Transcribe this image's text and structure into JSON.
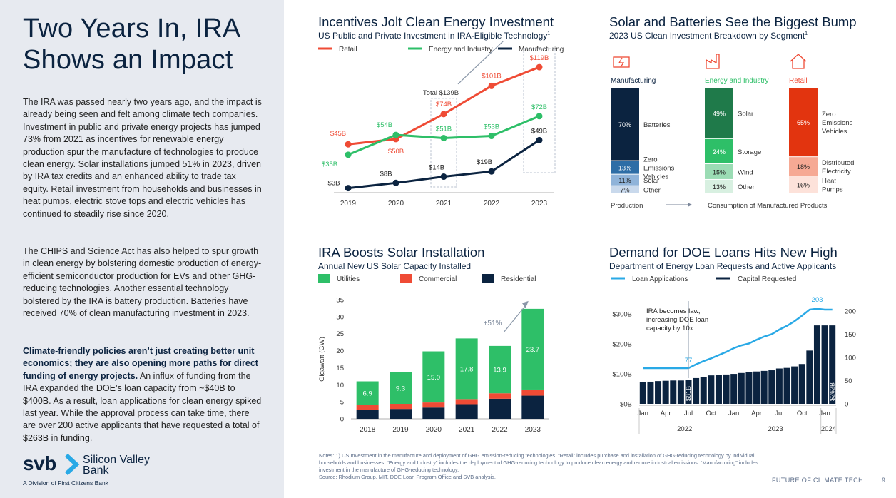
{
  "sidebar": {
    "title": "Two Years In, IRA Shows an Impact",
    "para1": "The IRA was passed nearly two years ago, and the impact is already being seen and felt among climate tech companies. Investment in public and private energy projects has jumped 73% from 2021 as incentives for renewable energy production spur the manufacture of technologies to produce clean energy. Solar installations jumped 51% in 2023, driven by IRA tax credits and an enhanced ability to trade tax equity. Retail investment from households and businesses in heat pumps, electric stove tops and electric vehicles has continued to steadily rise since 2020.",
    "para2": "The CHIPS and Science Act has also helped to spur growth in clean energy by bolstering domestic production of energy-efficient semiconductor production for EVs and other GHG-reducing technologies. Another essential technology bolstered by the IRA is battery production. Batteries have received 70% of clean manufacturing investment in 2023.",
    "para3_bold": "Climate-friendly policies aren’t just creating better unit economics; they are also opening more paths for direct funding of energy projects.",
    "para3_rest": " An influx of funding from the IRA expanded the DOE’s loan capacity from ~$40B to $400B. As a result, loan applications for clean energy spiked last year. While the approval process can take time, there are over 200 active applicants that have requested a total of $263B in funding.",
    "logo_mark": "svb",
    "logo_name_1": "Silicon Valley",
    "logo_name_2": "Bank",
    "logo_division": "A Division of First Citizens Bank"
  },
  "chart1": {
    "title": "Incentives Jolt Clean Energy Investment",
    "subtitle": "US Public and Private Investment in IRA-Eligible Technology",
    "subtitle_note": "1"
  },
  "chart2": {
    "title": "Solar and Batteries See the Biggest Bump",
    "subtitle": "2023 US Clean Investment Breakdown by Segment",
    "subtitle_note": "1"
  },
  "chart3": {
    "title": "IRA Boosts Solar Installation",
    "subtitle": "Annual New US Solar Capacity Installed"
  },
  "chart4": {
    "title": "Demand for DOE Loans Hits New High",
    "subtitle": "Department of Energy Loan Requests and Active Applicants"
  },
  "chart_data": [
    {
      "type": "line",
      "x": [
        "2019",
        "2020",
        "2021",
        "2022",
        "2023"
      ],
      "series": [
        {
          "name": "Retail",
          "color": "#ef4b35",
          "values": [
            45,
            50,
            74,
            101,
            119
          ],
          "labels": [
            "$45B",
            "$50B",
            "$74B",
            "$101B",
            "$119B"
          ]
        },
        {
          "name": "Energy and Industry",
          "color": "#2ebf68",
          "values": [
            35,
            54,
            51,
            53,
            72
          ],
          "labels": [
            "$35B",
            "$54B",
            "$51B",
            "$53B",
            "$72B"
          ]
        },
        {
          "name": "Manufacturing",
          "color": "#0b2340",
          "values": [
            3,
            8,
            14,
            19,
            49
          ],
          "labels": [
            "$3B",
            "$8B",
            "$14B",
            "$19B",
            "$49B"
          ]
        }
      ],
      "annotations": {
        "total_2021": "Total $139B",
        "total_2023": "Total $240B",
        "growth": "+73%"
      },
      "ylim": [
        0,
        130
      ]
    },
    {
      "type": "bar",
      "stacked": true,
      "percent": true,
      "segments": [
        {
          "name": "Manufacturing",
          "color": "#0b2340",
          "parts": [
            {
              "label": "Batteries",
              "value": 70,
              "text": "70%",
              "color": "#0b2340"
            },
            {
              "label": "Zero Emissions Vehicles",
              "value": 13,
              "text": "13%",
              "color": "#2d6da6"
            },
            {
              "label": "Solar",
              "value": 11,
              "text": "11%",
              "color": "#8fb3d9"
            },
            {
              "label": "Other",
              "value": 7,
              "text": "7%",
              "color": "#c9d9ec"
            }
          ]
        },
        {
          "name": "Energy and Industry",
          "color": "#2ebf68",
          "parts": [
            {
              "label": "Solar",
              "value": 49,
              "text": "49%",
              "color": "#1f7a4a"
            },
            {
              "label": "Storage",
              "value": 24,
              "text": "24%",
              "color": "#2ebf68"
            },
            {
              "label": "Wind",
              "value": 15,
              "text": "15%",
              "color": "#9bdcb4"
            },
            {
              "label": "Other",
              "value": 13,
              "text": "13%",
              "color": "#d8f0e1"
            }
          ]
        },
        {
          "name": "Retail",
          "color": "#ef4b35",
          "parts": [
            {
              "label": "Zero Emissions Vehicles",
              "value": 65,
              "text": "65%",
              "color": "#e2340f"
            },
            {
              "label": "Distributed Electricity",
              "value": 18,
              "text": "18%",
              "color": "#f6a994"
            },
            {
              "label": "Heat Pumps",
              "value": 16,
              "text": "16%",
              "color": "#fde2da"
            }
          ]
        }
      ],
      "bottom_left": "Production",
      "bottom_right": "Consumption of Manufactured Products"
    },
    {
      "type": "bar",
      "stacked": true,
      "categories": [
        "2018",
        "2019",
        "2020",
        "2021",
        "2022",
        "2023"
      ],
      "series": [
        {
          "name": "Residential",
          "color": "#0b2340",
          "values": [
            2.6,
            2.9,
            3.3,
            4.3,
            5.9,
            6.8
          ]
        },
        {
          "name": "Commercial",
          "color": "#ef4b35",
          "values": [
            1.5,
            1.5,
            1.5,
            1.5,
            1.6,
            1.8
          ]
        },
        {
          "name": "Utilities",
          "color": "#2ebf68",
          "values": [
            6.9,
            9.3,
            15.0,
            17.8,
            13.9,
            23.7
          ],
          "labels": [
            "6.9",
            "9.3",
            "15.0",
            "17.8",
            "13.9",
            "23.7"
          ]
        }
      ],
      "ylabel": "Gigawatt (GW)",
      "yticks": [
        "0",
        "5",
        "10",
        "15",
        "20",
        "25",
        "30",
        "35"
      ],
      "ylim": [
        0,
        35
      ],
      "growth": "+51%"
    },
    {
      "type": "bar",
      "combo_line": true,
      "legend": [
        {
          "name": "Loan Applications",
          "color": "#29a9e6"
        },
        {
          "name": "Capital Requested",
          "color": "#0b2340"
        }
      ],
      "capital_billions": [
        72,
        74,
        76,
        77,
        78,
        78,
        81,
        86,
        90,
        95,
        96,
        98,
        100,
        103,
        106,
        108,
        110,
        112,
        118,
        120,
        125,
        133,
        178,
        262,
        262,
        262
      ],
      "applications": [
        77,
        77,
        77,
        77,
        77,
        77,
        77,
        85,
        92,
        98,
        105,
        112,
        120,
        126,
        130,
        138,
        145,
        150,
        160,
        168,
        178,
        190,
        203,
        205,
        203,
        203
      ],
      "left_ticks": [
        "$0B",
        "$100B",
        "$200B",
        "$300B"
      ],
      "left_lim": [
        0,
        310
      ],
      "right_ticks": [
        "0",
        "50",
        "100",
        "150",
        "200"
      ],
      "right_lim": [
        0,
        200
      ],
      "month_ticks": [
        "Jan",
        "Apr",
        "Jul",
        "Oct",
        "Jan",
        "Apr",
        "Jul",
        "Oct",
        "Jan"
      ],
      "years": [
        "2022",
        "2023",
        "2024"
      ],
      "annotation": "IRA becomes law, increasing DOE loan capacity by 10x",
      "label_77": "77",
      "label_203": "203",
      "label_81": "$81B",
      "label_262": "$262B"
    }
  ],
  "notes": {
    "line1": "Notes: 1) US Investment in the manufacture and deployment of GHG emission-reducing technologies. “Retail” includes purchase and installation of GHG-reducing technology by individual households and businesses. “Energy and Industry” includes the deployment of GHG-reducing technology to produce clean energy and reduce industrial emissions. “Manufacturing” includes investment in the manufacture of GHG-reducing technology.",
    "source": "Source: Rhodium Group, MIT, DOE Loan Program Office and SVB analysis."
  },
  "footer": {
    "label": "FUTURE OF CLIMATE TECH",
    "page": "9"
  }
}
